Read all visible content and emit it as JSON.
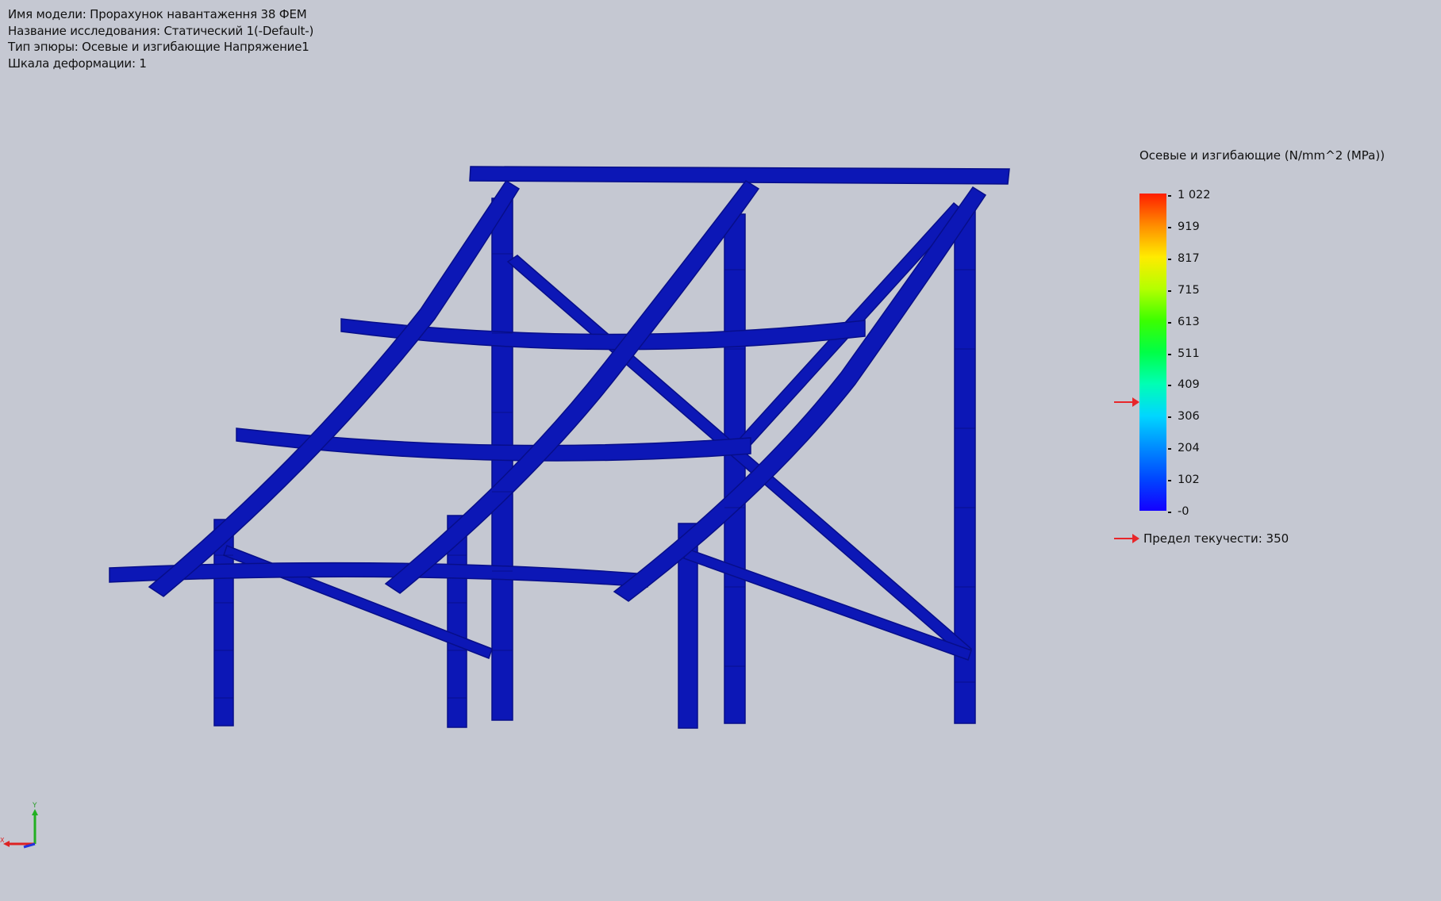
{
  "info": {
    "model_name": "Имя модели: Прорахунок навантаження 38 ФЕМ",
    "study_name": "Название исследования: Статический 1(-Default-)",
    "plot_type": "Тип эпюры: Осевые и изгибающие Напряжение1",
    "deformation_scale": "Шкала деформации: 1"
  },
  "legend": {
    "title": "Осевые и изгибающие (N/mm^2 (MPa))",
    "ticks": [
      "1 022",
      "919",
      "817",
      "715",
      "613",
      "511",
      "409",
      "306",
      "204",
      "102",
      "-0"
    ],
    "yield_label": "Предел текучести: 350",
    "yield_value": 350,
    "max_value": 1022,
    "min_value": 0
  },
  "colors": {
    "background": "#c5c8d2",
    "beam": "#0c17b6",
    "beam_shade": "#070e8a",
    "arrow": "#e8262a"
  },
  "triad": {
    "y_label": "Y",
    "x_label": "X"
  }
}
